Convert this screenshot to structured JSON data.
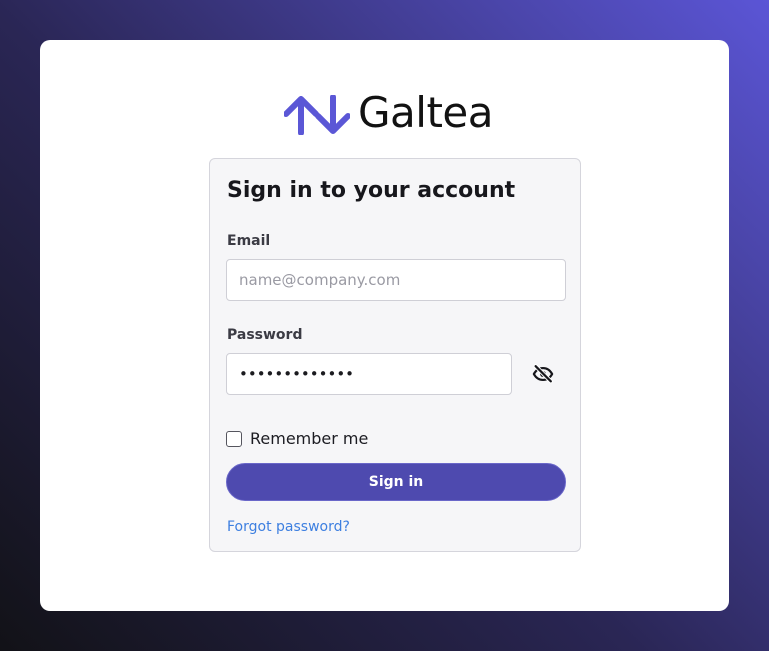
{
  "brand": {
    "name": "Galtea",
    "accent_color": "#5b57d6",
    "logo_icon": "up-down-arrows-icon"
  },
  "login": {
    "title": "Sign in to your account",
    "email": {
      "label": "Email",
      "placeholder": "name@company.com",
      "value": ""
    },
    "password": {
      "label": "Password",
      "masked_value": "•••••••••••••",
      "toggle_icon": "eye-slash-icon"
    },
    "remember_me": {
      "label": "Remember me",
      "checked": false
    },
    "submit_label": "Sign in",
    "forgot_password_label": "Forgot password?"
  },
  "colors": {
    "button": "#4e4aaf",
    "link": "#3d7fe0",
    "card_background": "#f6f6f8"
  }
}
